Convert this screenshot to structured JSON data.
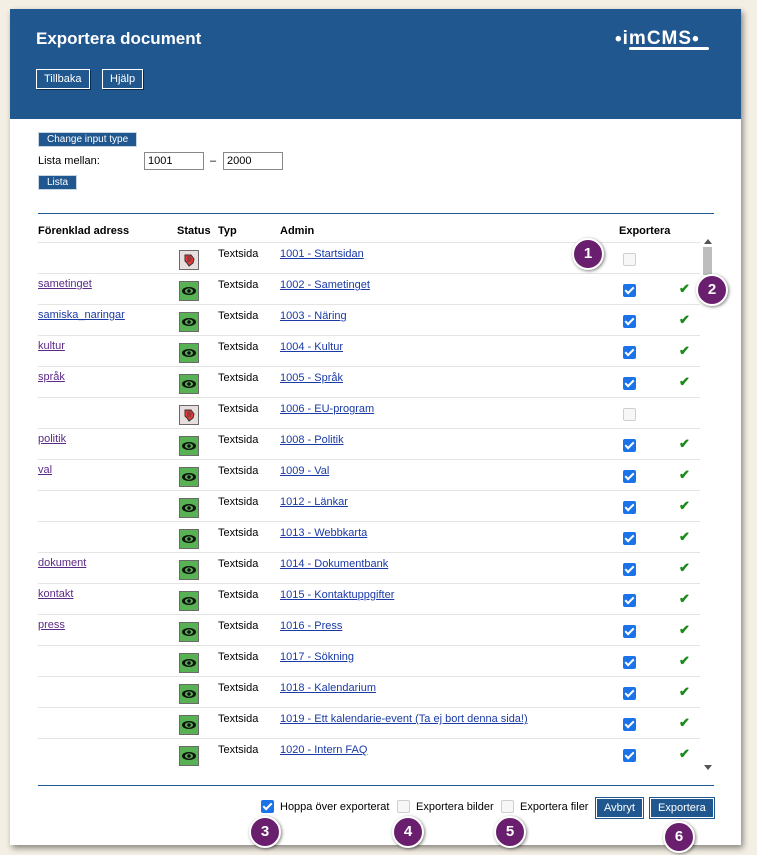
{
  "window": {
    "title": "Exportera document",
    "logo": "imCMS",
    "back_label": "Tillbaka",
    "help_label": "Hjälp"
  },
  "range": {
    "change_input_label": "Change input type",
    "label": "Lista mellan:",
    "from": "1001",
    "separator": "–",
    "to": "2000",
    "list_label": "Lista"
  },
  "table": {
    "headers": {
      "address": "Förenklad adress",
      "status": "Status",
      "type": "Typ",
      "admin": "Admin",
      "export": "Exportera"
    },
    "rows": [
      {
        "address": "",
        "status": "unpublished",
        "type": "Textsida",
        "admin": "1001 - Startsidan",
        "export": false,
        "exported": false
      },
      {
        "address": "sametinget",
        "status": "published",
        "type": "Textsida",
        "admin": "1002 - Sametinget",
        "export": true,
        "exported": true
      },
      {
        "address": "samiska_naringar",
        "status": "published",
        "type": "Textsida",
        "admin": "1003 - Näring",
        "export": true,
        "exported": true
      },
      {
        "address": "kultur",
        "status": "published",
        "type": "Textsida",
        "admin": "1004 - Kultur",
        "export": true,
        "exported": true
      },
      {
        "address": "språk",
        "status": "published",
        "type": "Textsida",
        "admin": "1005 - Språk",
        "export": true,
        "exported": true
      },
      {
        "address": "",
        "status": "unpublished",
        "type": "Textsida",
        "admin": "1006 - EU-program",
        "export": false,
        "exported": false
      },
      {
        "address": "politik",
        "status": "published",
        "type": "Textsida",
        "admin": "1008 - Politik",
        "export": true,
        "exported": true
      },
      {
        "address": "val",
        "status": "published",
        "type": "Textsida",
        "admin": "1009 - Val",
        "export": true,
        "exported": true
      },
      {
        "address": "",
        "status": "published",
        "type": "Textsida",
        "admin": "1012 - Länkar",
        "export": true,
        "exported": true
      },
      {
        "address": "",
        "status": "published",
        "type": "Textsida",
        "admin": "1013 - Webbkarta",
        "export": true,
        "exported": true
      },
      {
        "address": "dokument",
        "status": "published",
        "type": "Textsida",
        "admin": "1014 - Dokumentbank",
        "export": true,
        "exported": true
      },
      {
        "address": "kontakt",
        "status": "published",
        "type": "Textsida",
        "admin": "1015 - Kontaktuppgifter",
        "export": true,
        "exported": true
      },
      {
        "address": "press",
        "status": "published",
        "type": "Textsida",
        "admin": "1016 - Press",
        "export": true,
        "exported": true
      },
      {
        "address": "",
        "status": "published",
        "type": "Textsida",
        "admin": "1017 - Sökning",
        "export": true,
        "exported": true
      },
      {
        "address": "",
        "status": "published",
        "type": "Textsida",
        "admin": "1018 - Kalendarium",
        "export": true,
        "exported": true
      },
      {
        "address": "",
        "status": "published",
        "type": "Textsida",
        "admin": "1019 - Ett kalendarie-event (Ta ej bort denna sida!)",
        "export": true,
        "exported": true
      },
      {
        "address": "",
        "status": "published",
        "type": "Textsida",
        "admin": "1020 - Intern FAQ",
        "export": true,
        "exported": true
      }
    ]
  },
  "footer": {
    "skip_exported_label": "Hoppa över exporterat",
    "skip_exported": true,
    "export_images_label": "Exportera bilder",
    "export_images": false,
    "export_files_label": "Exportera filer",
    "export_files": false,
    "cancel_label": "Avbryt",
    "export_label": "Exportera"
  },
  "badges": [
    "1",
    "2",
    "3",
    "4",
    "5",
    "6"
  ],
  "colors": {
    "header": "#20578f",
    "badge": "#6a1f6e",
    "checkbox": "#1a73e8",
    "ok_check": "#1a8a1a",
    "published_status": "#58b253"
  }
}
